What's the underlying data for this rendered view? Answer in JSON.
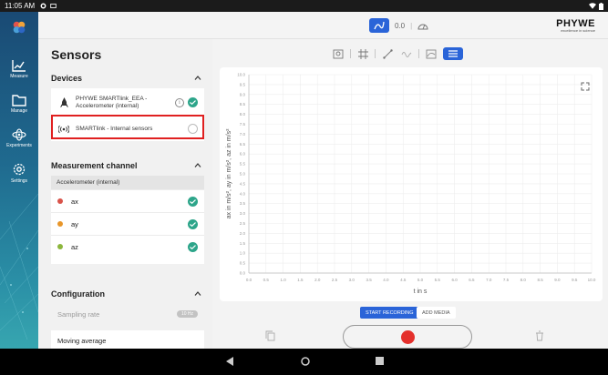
{
  "status_bar": {
    "time": "11:05 AM"
  },
  "nav_rail": {
    "items": [
      {
        "label": "Measure",
        "icon": "chart-icon"
      },
      {
        "label": "Manage",
        "icon": "folder-icon"
      },
      {
        "label": "Experiments",
        "icon": "atom-icon"
      },
      {
        "label": "Settings",
        "icon": "gear-icon"
      }
    ]
  },
  "topbar": {
    "mode_value": "0.0",
    "brand_name": "PHYWE",
    "brand_tagline": "excellence in science"
  },
  "sensors_panel": {
    "title": "Sensors",
    "devices": {
      "heading": "Devices",
      "items": [
        {
          "name": "PHYWE SMARTlink_EEA - Accelerometer (internal)",
          "checked": true
        },
        {
          "name": "SMARTlink - Internal sensors",
          "checked": false
        }
      ]
    },
    "measurement_channel": {
      "heading": "Measurement channel",
      "subheading": "Accelerometer (internal)",
      "channels": [
        {
          "label": "ax",
          "color": "#d9534a"
        },
        {
          "label": "ay",
          "color": "#e8962a"
        },
        {
          "label": "az",
          "color": "#8cb63c"
        }
      ]
    },
    "configuration": {
      "heading": "Configuration",
      "sampling_rate_label": "Sampling rate",
      "sampling_rate_value": "10 Hz",
      "moving_average_label": "Moving average"
    }
  },
  "chart_data": {
    "type": "line",
    "series": [],
    "xlabel": "t in s",
    "ylabel": "ax in m/s², ay in m/s², az in m/s²",
    "xlim": [
      0,
      10
    ],
    "ylim": [
      0,
      10
    ],
    "x_ticks": [
      "0.0",
      "0.5",
      "1.0",
      "1.5",
      "2.0",
      "2.5",
      "3.0",
      "3.5",
      "4.0",
      "4.5",
      "5.0",
      "5.5",
      "6.0",
      "6.5",
      "7.0",
      "7.5",
      "8.0",
      "8.5",
      "9.0",
      "9.5",
      "10.0"
    ],
    "y_ticks": [
      "0.0",
      "0.5",
      "1.0",
      "1.5",
      "2.0",
      "2.5",
      "3.0",
      "3.5",
      "4.0",
      "4.5",
      "5.0",
      "5.5",
      "6.0",
      "6.5",
      "7.0",
      "7.5",
      "8.0",
      "8.5",
      "9.0",
      "9.5",
      "10.0"
    ],
    "grid": true
  },
  "actions": {
    "start_recording": "START RECORDING",
    "add_media": "ADD MEDIA"
  },
  "colors": {
    "accent": "#2a64d8",
    "check": "#2da58a",
    "record": "#e4302c",
    "highlight": "#e02020"
  }
}
